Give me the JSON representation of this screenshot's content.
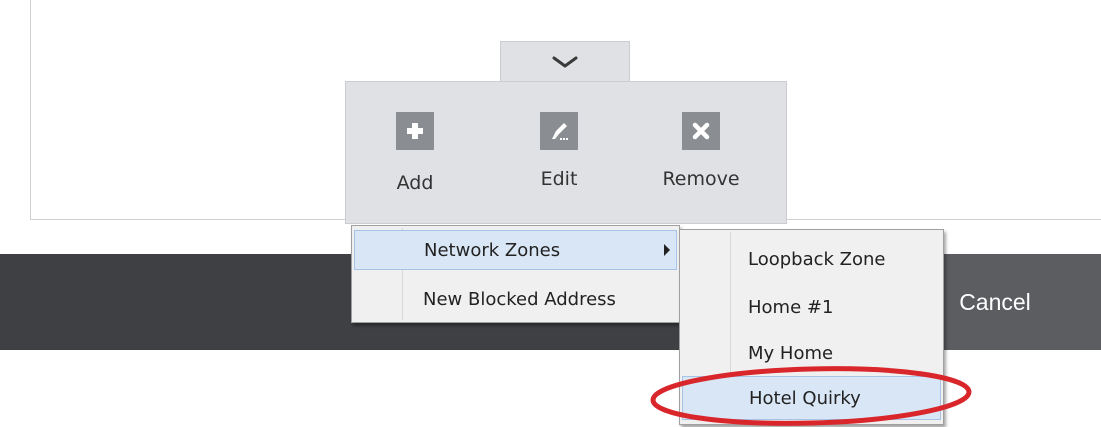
{
  "toolbar": {
    "add_label": "Add",
    "edit_label": "Edit",
    "remove_label": "Remove"
  },
  "add_menu": {
    "items": [
      {
        "label": "Network Zones",
        "has_submenu": true,
        "highlighted": true
      },
      {
        "label": "New Blocked Address",
        "has_submenu": false,
        "highlighted": false
      }
    ]
  },
  "zones_submenu": {
    "items": [
      {
        "label": "Loopback Zone"
      },
      {
        "label": "Home #1"
      },
      {
        "label": "My Home"
      },
      {
        "label": "Hotel Quirky",
        "highlighted": true
      }
    ]
  },
  "footer": {
    "cancel_label": "Cancel"
  },
  "colors": {
    "dark_bar": "#3e4043",
    "highlight_ring": "#d9262b",
    "menu_hover": "#d9e6f5"
  }
}
